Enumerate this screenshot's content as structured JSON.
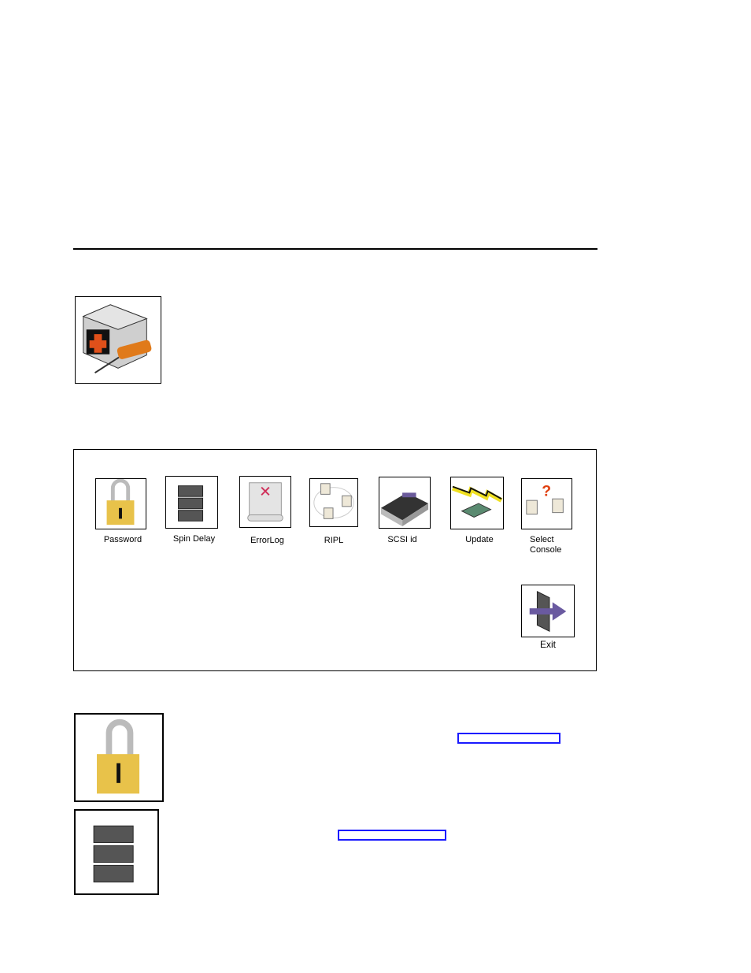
{
  "menu": {
    "items": [
      {
        "label": "Password",
        "icon": "padlock-icon"
      },
      {
        "label": "Spin Delay",
        "icon": "server-stack-icon"
      },
      {
        "label": "ErrorLog",
        "icon": "error-log-scroll-icon"
      },
      {
        "label": "RIPL",
        "icon": "network-ring-icon"
      },
      {
        "label": "SCSI id",
        "icon": "scsi-device-icon"
      },
      {
        "label": "Update",
        "icon": "flash-update-icon"
      },
      {
        "label": "Select\nConsole",
        "icon": "select-console-icon"
      }
    ],
    "exit_label": "Exit"
  },
  "colors": {
    "link": "#1a1aff",
    "lock": "#e8c24a",
    "toolbox_accent": "#e0501a"
  }
}
